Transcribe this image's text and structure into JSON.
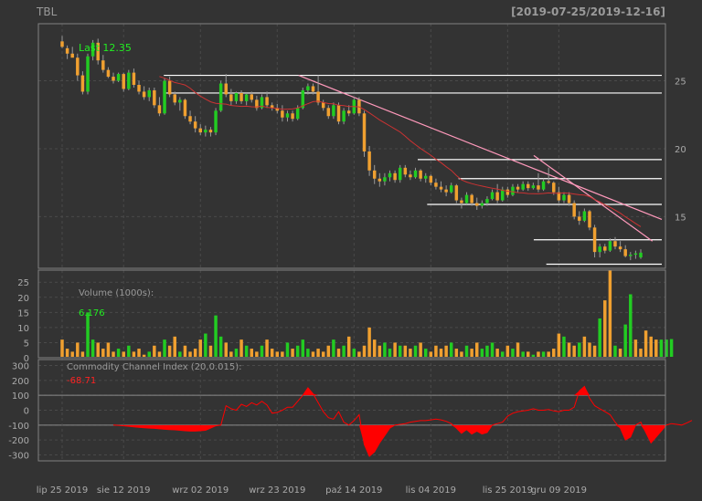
{
  "chart_data": {
    "type": "candlestick",
    "ticker": "TBL",
    "date_range": "[2019-07-25/2019-12-16]",
    "colors": {
      "background": "#333333",
      "panel_border": "#808080",
      "grid": "#4a4a4a",
      "up": "#22cc22",
      "down": "#f0a030",
      "ma": "#cc3333",
      "trendline": "#ff99bb",
      "hline": "#ffffff",
      "label_green": "#22ee22",
      "label_red": "#ff2222",
      "text": "#aaaaaa",
      "cci_fill": "#ff0000"
    },
    "price_panel": {
      "last_label": "Last 12.35",
      "y_ticks": [
        15,
        20,
        25
      ],
      "ylim": [
        11.2,
        29.2
      ],
      "candles": [
        [
          27.9,
          28.3,
          27.4,
          27.5
        ],
        [
          27.4,
          27.6,
          26.6,
          27.0
        ],
        [
          27.0,
          27.5,
          26.8,
          26.7
        ],
        [
          26.7,
          27.0,
          25.0,
          25.4
        ],
        [
          25.4,
          25.7,
          24.0,
          24.2
        ],
        [
          24.2,
          27.0,
          24.0,
          26.8
        ],
        [
          26.8,
          28.0,
          26.5,
          27.8
        ],
        [
          27.8,
          28.1,
          26.2,
          26.5
        ],
        [
          26.5,
          26.9,
          25.6,
          25.8
        ],
        [
          25.8,
          26.0,
          25.2,
          25.3
        ],
        [
          25.3,
          25.6,
          24.8,
          25.0
        ],
        [
          25.0,
          25.6,
          24.9,
          25.5
        ],
        [
          25.5,
          25.6,
          24.2,
          24.4
        ],
        [
          24.4,
          25.8,
          24.3,
          25.6
        ],
        [
          25.6,
          25.9,
          24.5,
          24.7
        ],
        [
          24.7,
          25.0,
          24.0,
          24.2
        ],
        [
          24.2,
          24.6,
          23.6,
          23.8
        ],
        [
          23.8,
          24.5,
          23.5,
          24.3
        ],
        [
          24.3,
          24.5,
          23.0,
          23.2
        ],
        [
          23.2,
          23.8,
          22.4,
          22.6
        ],
        [
          22.6,
          25.2,
          22.5,
          25.0
        ],
        [
          25.0,
          25.3,
          23.8,
          24.0
        ],
        [
          24.0,
          24.2,
          23.2,
          23.4
        ],
        [
          23.4,
          23.8,
          22.8,
          23.6
        ],
        [
          23.6,
          23.7,
          22.2,
          22.4
        ],
        [
          22.4,
          22.8,
          21.8,
          22.0
        ],
        [
          22.0,
          22.4,
          21.2,
          21.5
        ],
        [
          21.5,
          21.8,
          21.0,
          21.2
        ],
        [
          21.2,
          21.7,
          20.9,
          21.4
        ],
        [
          21.4,
          21.6,
          20.9,
          21.2
        ],
        [
          21.2,
          23.0,
          21.0,
          22.8
        ],
        [
          22.8,
          25.0,
          22.7,
          24.8
        ],
        [
          24.8,
          25.5,
          23.8,
          24.0
        ],
        [
          24.0,
          24.4,
          23.2,
          23.5
        ],
        [
          23.5,
          24.2,
          23.3,
          24.1
        ],
        [
          24.1,
          24.3,
          23.3,
          23.5
        ],
        [
          23.5,
          24.1,
          23.2,
          24.0
        ],
        [
          24.0,
          24.2,
          23.4,
          23.6
        ],
        [
          23.6,
          23.9,
          22.8,
          23.0
        ],
        [
          23.0,
          24.0,
          22.9,
          23.8
        ],
        [
          23.8,
          24.2,
          23.0,
          23.2
        ],
        [
          23.2,
          23.4,
          22.8,
          23.0
        ],
        [
          23.0,
          23.3,
          22.6,
          22.8
        ],
        [
          22.8,
          23.2,
          22.0,
          22.3
        ],
        [
          22.3,
          22.8,
          22.0,
          22.6
        ],
        [
          22.6,
          22.8,
          22.0,
          22.2
        ],
        [
          22.2,
          23.2,
          22.1,
          23.0
        ],
        [
          23.0,
          24.5,
          22.9,
          24.3
        ],
        [
          24.3,
          24.8,
          24.0,
          24.6
        ],
        [
          24.6,
          24.8,
          24.0,
          24.2
        ],
        [
          24.2,
          25.4,
          23.2,
          23.4
        ],
        [
          23.4,
          23.6,
          22.8,
          23.0
        ],
        [
          23.0,
          23.2,
          22.2,
          22.4
        ],
        [
          22.4,
          23.4,
          22.2,
          23.2
        ],
        [
          23.2,
          23.4,
          21.8,
          22.0
        ],
        [
          22.0,
          23.0,
          21.8,
          22.8
        ],
        [
          22.8,
          23.2,
          22.4,
          22.6
        ],
        [
          22.6,
          23.8,
          22.5,
          23.6
        ],
        [
          23.6,
          23.8,
          22.4,
          22.6
        ],
        [
          22.6,
          22.8,
          19.4,
          19.8
        ],
        [
          19.8,
          20.2,
          18.0,
          18.4
        ],
        [
          18.4,
          18.8,
          17.4,
          17.8
        ],
        [
          17.8,
          18.2,
          17.2,
          17.6
        ],
        [
          17.6,
          18.2,
          17.3,
          17.9
        ],
        [
          17.9,
          18.4,
          17.6,
          18.2
        ],
        [
          18.2,
          18.4,
          17.5,
          17.7
        ],
        [
          17.7,
          18.8,
          17.5,
          18.6
        ],
        [
          18.6,
          18.8,
          17.9,
          18.1
        ],
        [
          18.1,
          18.4,
          17.7,
          17.9
        ],
        [
          17.9,
          18.6,
          17.8,
          18.4
        ],
        [
          18.4,
          18.5,
          17.6,
          17.8
        ],
        [
          17.8,
          18.2,
          17.5,
          18.0
        ],
        [
          18.0,
          18.1,
          17.3,
          17.5
        ],
        [
          17.5,
          17.8,
          17.0,
          17.2
        ],
        [
          17.2,
          17.6,
          16.8,
          17.0
        ],
        [
          17.0,
          17.3,
          16.5,
          16.8
        ],
        [
          16.8,
          17.5,
          16.7,
          17.3
        ],
        [
          17.3,
          17.4,
          16.0,
          16.2
        ],
        [
          16.2,
          16.4,
          15.6,
          16.0
        ],
        [
          16.0,
          16.8,
          15.9,
          16.6
        ],
        [
          16.6,
          16.7,
          15.8,
          16.0
        ],
        [
          16.0,
          16.4,
          15.5,
          15.8
        ],
        [
          15.8,
          16.2,
          15.6,
          16.0
        ],
        [
          16.0,
          16.5,
          15.8,
          16.3
        ],
        [
          16.3,
          17.0,
          16.2,
          16.8
        ],
        [
          16.8,
          17.4,
          16.0,
          16.2
        ],
        [
          16.2,
          17.2,
          16.1,
          17.0
        ],
        [
          17.0,
          17.2,
          16.4,
          16.6
        ],
        [
          16.6,
          17.4,
          16.5,
          17.2
        ],
        [
          17.2,
          17.4,
          16.8,
          17.0
        ],
        [
          17.0,
          17.6,
          16.9,
          17.4
        ],
        [
          17.4,
          17.6,
          16.9,
          17.1
        ],
        [
          17.1,
          17.5,
          17.0,
          17.3
        ],
        [
          17.3,
          18.2,
          16.8,
          17.0
        ],
        [
          17.0,
          17.8,
          16.9,
          17.6
        ],
        [
          17.6,
          18.6,
          17.4,
          17.5
        ],
        [
          17.5,
          17.6,
          16.6,
          16.8
        ],
        [
          16.8,
          17.2,
          16.0,
          16.2
        ],
        [
          16.2,
          16.8,
          16.0,
          16.6
        ],
        [
          16.6,
          16.8,
          15.8,
          16.0
        ],
        [
          16.0,
          16.2,
          14.8,
          15.0
        ],
        [
          15.0,
          15.4,
          14.4,
          14.7
        ],
        [
          14.7,
          15.6,
          14.6,
          15.4
        ],
        [
          15.4,
          15.5,
          14.0,
          14.2
        ],
        [
          14.2,
          14.4,
          12.0,
          12.4
        ],
        [
          12.4,
          13.0,
          12.0,
          12.8
        ],
        [
          12.8,
          13.0,
          12.3,
          12.5
        ],
        [
          12.5,
          13.4,
          12.4,
          13.2
        ],
        [
          13.2,
          13.5,
          12.6,
          12.8
        ],
        [
          12.8,
          13.2,
          12.4,
          12.6
        ],
        [
          12.6,
          12.9,
          12.0,
          12.1
        ],
        [
          12.1,
          12.4,
          11.8,
          12.2
        ],
        [
          12.2,
          12.5,
          11.9,
          12.3
        ],
        [
          12.0,
          12.6,
          11.9,
          12.35
        ]
      ],
      "hlines": [
        {
          "y": 25.4,
          "x_start": 0.2,
          "x_end": 1.0
        },
        {
          "y": 24.1,
          "x_start": 0.2,
          "x_end": 1.0
        },
        {
          "y": 19.2,
          "x_start": 0.605,
          "x_end": 1.0
        },
        {
          "y": 17.8,
          "x_start": 0.67,
          "x_end": 1.0
        },
        {
          "y": 15.9,
          "x_start": 0.62,
          "x_end": 1.0
        },
        {
          "y": 13.3,
          "x_start": 0.79,
          "x_end": 1.0
        },
        {
          "y": 11.5,
          "x_start": 0.81,
          "x_end": 1.0
        }
      ],
      "trendlines": [
        {
          "x0": 0.415,
          "y0": 25.4,
          "x1": 1.0,
          "y1": 14.8
        },
        {
          "x0": 0.79,
          "y0": 19.5,
          "x1": 0.985,
          "y1": 13.2
        }
      ]
    },
    "volume_panel": {
      "label": "Volume (1000s):",
      "last_value": "6.176",
      "y_ticks": [
        0,
        5,
        10,
        15,
        20,
        25
      ],
      "ylim": [
        0,
        29
      ],
      "values": [
        6,
        3,
        2,
        5,
        2,
        15,
        6,
        5,
        3,
        5,
        2,
        3,
        2,
        4,
        2,
        3,
        1,
        2,
        4,
        2,
        6,
        4,
        7,
        2,
        4,
        2,
        3,
        6,
        8,
        4,
        14,
        7,
        5,
        2,
        3,
        6,
        4,
        3,
        2,
        4,
        6,
        3,
        2,
        2,
        5,
        3,
        4,
        6,
        3,
        2,
        3,
        2,
        4,
        6,
        3,
        4,
        7,
        3,
        2,
        4,
        10,
        6,
        4,
        5,
        3,
        5,
        4,
        4,
        3,
        4,
        5,
        3,
        2,
        4,
        3,
        4,
        5,
        3,
        2,
        4,
        3,
        5,
        3,
        4,
        5,
        3,
        2,
        4,
        3,
        5,
        2,
        2,
        1,
        2,
        2,
        2,
        3,
        8,
        7,
        5,
        4,
        5,
        7,
        5,
        4,
        13,
        19,
        29,
        4,
        3,
        11,
        21,
        6,
        3,
        9,
        7,
        6,
        6,
        6,
        6.176
      ],
      "up": [
        0,
        0,
        0,
        0,
        0,
        1,
        1,
        0,
        0,
        0,
        0,
        1,
        0,
        1,
        0,
        0,
        0,
        1,
        0,
        0,
        1,
        0,
        0,
        1,
        0,
        0,
        0,
        0,
        1,
        0,
        1,
        1,
        0,
        0,
        1,
        0,
        1,
        0,
        0,
        1,
        0,
        0,
        0,
        0,
        1,
        0,
        1,
        1,
        1,
        0,
        0,
        0,
        0,
        1,
        0,
        1,
        0,
        1,
        0,
        0,
        0,
        0,
        0,
        1,
        1,
        0,
        1,
        0,
        0,
        1,
        0,
        1,
        0,
        0,
        0,
        0,
        1,
        0,
        0,
        1,
        0,
        0,
        1,
        1,
        1,
        0,
        1,
        0,
        1,
        0,
        1,
        0,
        1,
        0,
        1,
        0,
        0,
        0,
        1,
        0,
        0,
        1,
        0,
        0,
        0,
        1,
        0,
        0,
        1,
        0,
        1,
        1,
        0,
        0,
        0,
        0,
        0,
        1,
        1,
        1
      ]
    },
    "cci_panel": {
      "label": "Commodity Channel Index (20,0.015):",
      "last_value": "-68.71",
      "y_ticks": [
        -300,
        -200,
        -100,
        0,
        100,
        200,
        300
      ],
      "ylim": [
        -340,
        340
      ],
      "values": [
        null,
        null,
        null,
        null,
        null,
        null,
        null,
        null,
        null,
        null,
        -100,
        -102,
        -105,
        -108,
        -112,
        -115,
        -118,
        -120,
        -122,
        -125,
        -128,
        -130,
        -132,
        -135,
        -138,
        -140,
        -140,
        -138,
        -135,
        -120,
        -105,
        -100,
        30,
        10,
        0,
        40,
        25,
        50,
        35,
        60,
        35,
        -20,
        -15,
        0,
        20,
        20,
        60,
        100,
        150,
        110,
        50,
        -10,
        -50,
        -60,
        -10,
        -80,
        -100,
        -70,
        -30,
        -230,
        -310,
        -280,
        -220,
        -170,
        -120,
        -100,
        -95,
        -90,
        -80,
        -75,
        -70,
        -70,
        -65,
        -60,
        -65,
        -75,
        -90,
        -120,
        -155,
        -130,
        -160,
        -140,
        -160,
        -150,
        -100,
        -90,
        -80,
        -40,
        -20,
        -10,
        -5,
        0,
        10,
        0,
        0,
        5,
        -5,
        -10,
        0,
        0,
        20,
        130,
        160,
        80,
        30,
        10,
        -10,
        -30,
        -80,
        -120,
        -200,
        -180,
        -100,
        -80,
        -150,
        -220,
        -180,
        -140,
        -100,
        -90,
        -95,
        -100,
        -85,
        -68.71
      ],
      "ref_lines": [
        100,
        -100
      ]
    },
    "x_axis": {
      "tick_labels": [
        "lip 25 2019",
        "sie 12 2019",
        "wrz 02 2019",
        "wrz 23 2019",
        "paź 14 2019",
        "lis 04 2019",
        "lis 25 2019",
        "gru 09 2019"
      ],
      "tick_index": [
        0,
        12,
        27,
        42,
        57,
        72,
        87,
        97
      ]
    }
  }
}
